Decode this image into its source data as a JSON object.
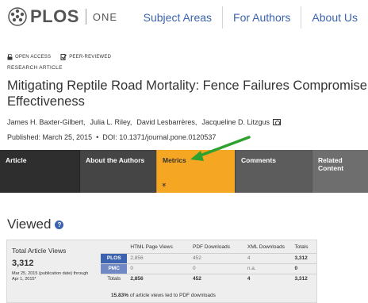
{
  "header": {
    "logo_text": "PLOS",
    "logo_suffix": "ONE",
    "nav": [
      "Subject Areas",
      "For Authors",
      "About Us"
    ],
    "accent_color": "#3c63af"
  },
  "article": {
    "badges": [
      "OPEN ACCESS",
      "PEER-REVIEWED"
    ],
    "type": "RESEARCH ARTICLE",
    "title": "Mitigating Reptile Road Mortality: Fence Failures Compromise Effectiveness",
    "authors": [
      "James H. Baxter-Gilbert,",
      "Julia L. Riley,",
      "David Lesbarrères,",
      "Jacqueline D. Litzgus"
    ],
    "published": "Published: March 25, 2015",
    "doi": "DOI: 10.1371/journal.pone.0120537"
  },
  "tabs": [
    {
      "label": "Article"
    },
    {
      "label": "About the Authors"
    },
    {
      "label": "Metrics",
      "active": true,
      "chevron": "»"
    },
    {
      "label": "Comments"
    },
    {
      "label": "Related Content"
    }
  ],
  "viewed": {
    "heading": "Viewed",
    "help": "?",
    "total_label": "Total Article Views",
    "total_value": "3,312",
    "date_range": "Mar 25, 2015 (publication date) through Apr 1, 2015*",
    "columns": [
      "",
      "HTML Page Views",
      "PDF Downloads",
      "XML Downloads",
      "Totals"
    ],
    "rows": [
      {
        "source": "PLOS",
        "html": "2,856",
        "pdf": "452",
        "xml": "4",
        "total": "3,312"
      },
      {
        "source": "PMC",
        "html": "0",
        "pdf": "0",
        "xml": "n.a.",
        "total": "0"
      },
      {
        "source": "Totals",
        "html": "2,856",
        "pdf": "452",
        "xml": "4",
        "total": "3,312"
      }
    ],
    "footnote_pct": "15.83%",
    "footnote_text": " of article views led to PDF downloads"
  },
  "annotation": {
    "arrow_color": "#2ea12e"
  }
}
